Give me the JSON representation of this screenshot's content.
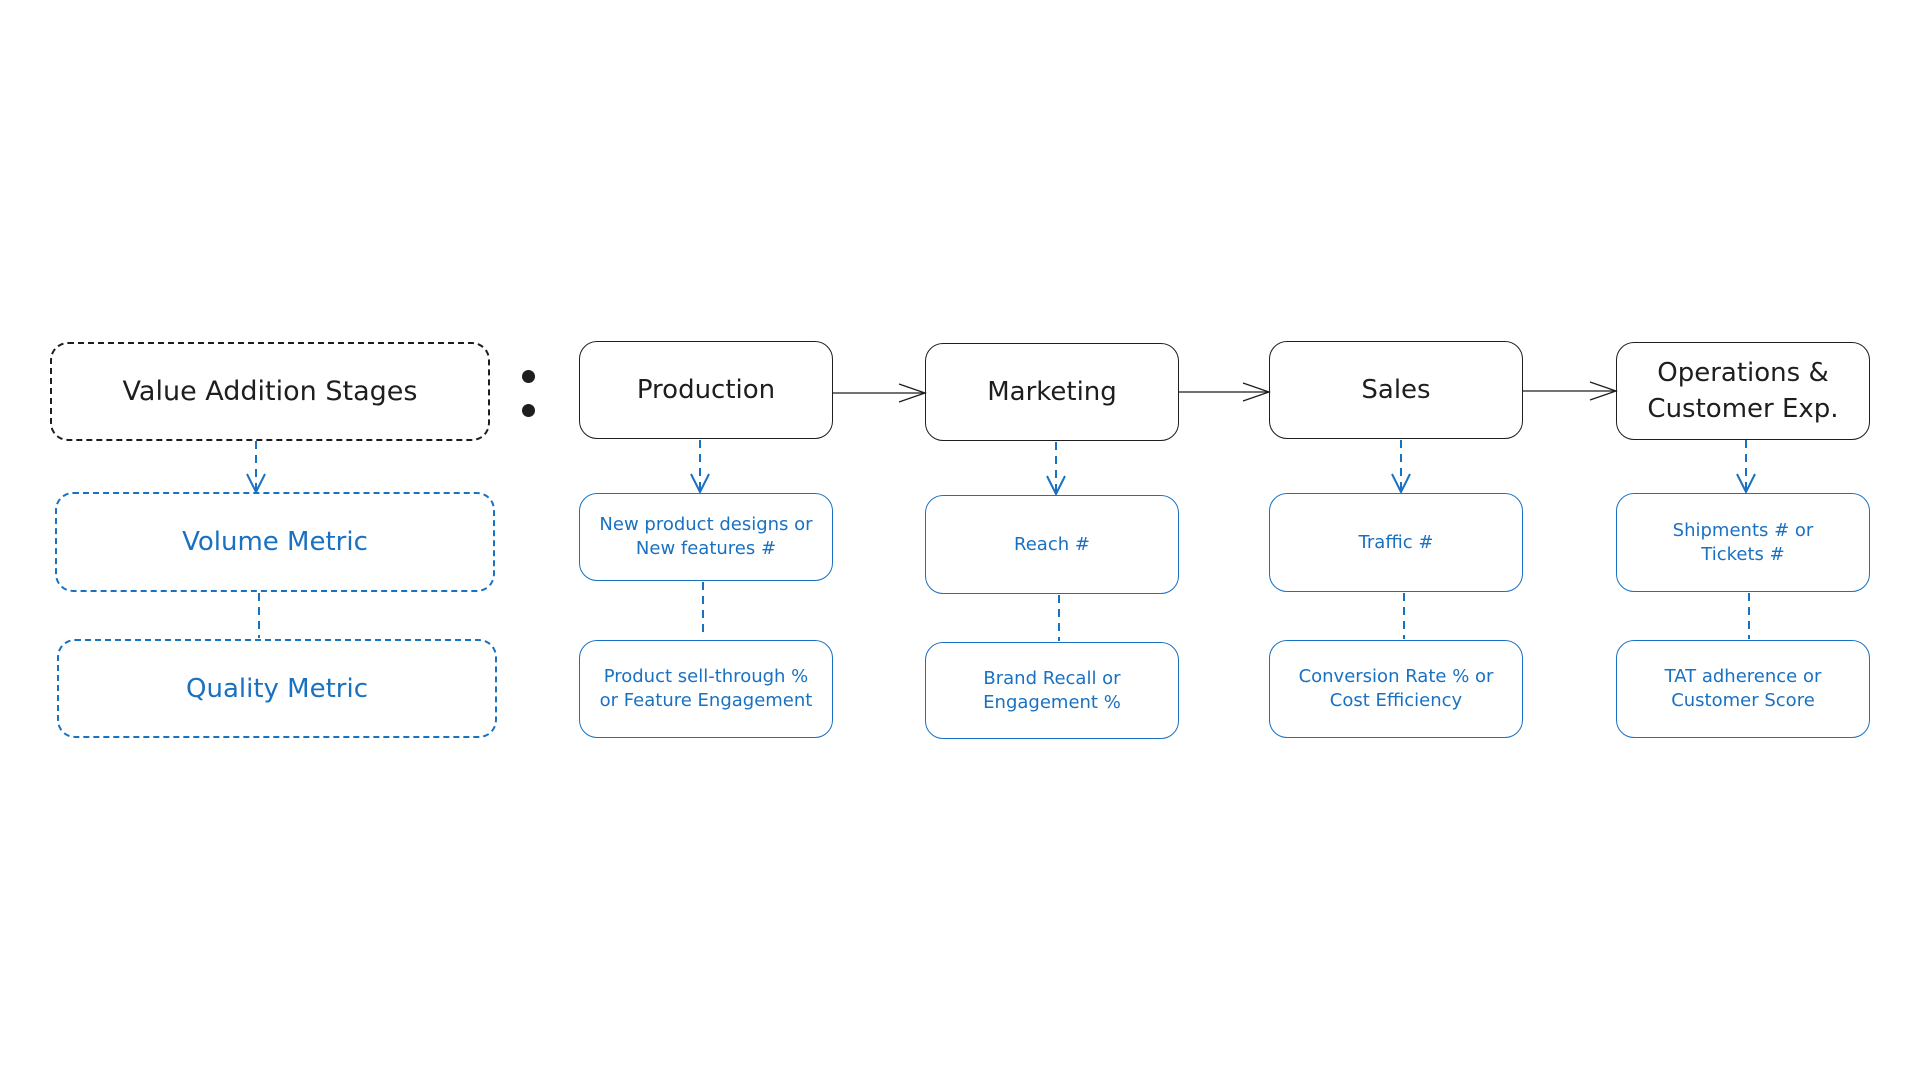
{
  "legend": {
    "header": "Value Addition Stages",
    "volume_label": "Volume Metric",
    "quality_label": "Quality Metric"
  },
  "stages": [
    {
      "name": "Production",
      "volume": "New product designs or\nNew features #",
      "quality": "Product sell-through %\nor Feature Engagement"
    },
    {
      "name": "Marketing",
      "volume": "Reach #",
      "quality": "Brand Recall or\nEngagement %"
    },
    {
      "name": "Sales",
      "volume": "Traffic #",
      "quality": "Conversion Rate % or\nCost Efficiency"
    },
    {
      "name": "Operations &\nCustomer Exp.",
      "volume": "Shipments # or\nTickets #",
      "quality": "TAT adherence or\nCustomer Score"
    }
  ],
  "colors": {
    "stroke": "#1e1e1e",
    "accent": "#1971c2"
  }
}
